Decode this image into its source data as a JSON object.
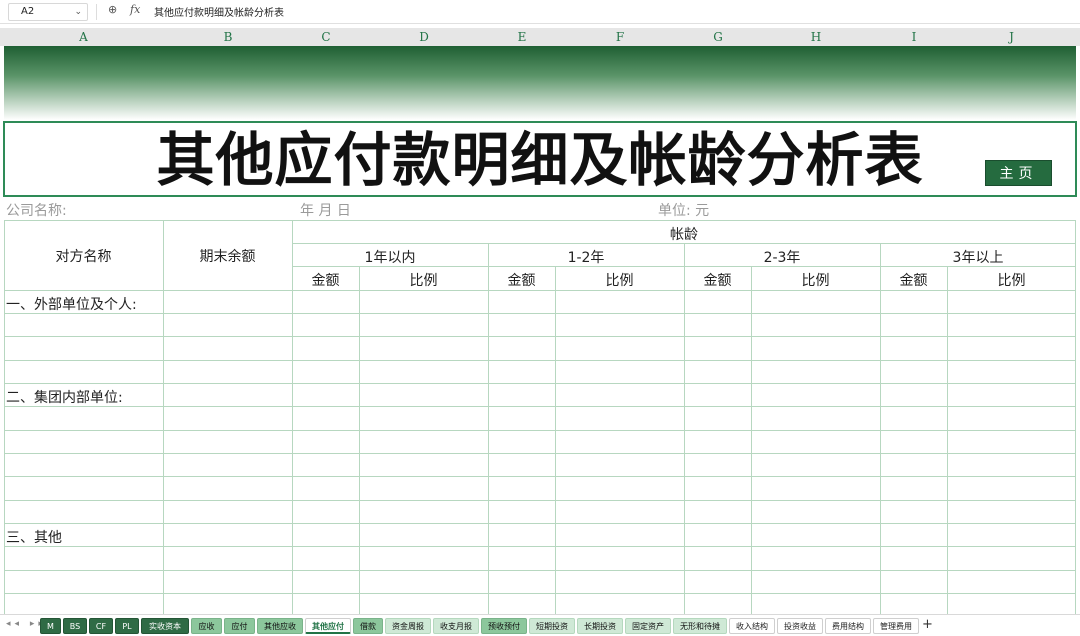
{
  "formula_bar": {
    "cell_ref": "A2",
    "dropdown_glyph": "⌄",
    "zoom_glyph": "⊕",
    "fx_label": "fx",
    "formula": "其他应付款明细及帐龄分析表"
  },
  "columns": [
    "A",
    "B",
    "C",
    "D",
    "E",
    "F",
    "G",
    "H",
    "I",
    "J"
  ],
  "sheet": {
    "title": "其他应付款明细及帐龄分析表",
    "home_button": "主页",
    "company_label": "公司名称:",
    "date_label": "年    月    日",
    "unit_label": "单位: 元",
    "headers": {
      "counterparty": "对方名称",
      "ending_balance": "期末余额",
      "aging": "帐龄",
      "buckets": [
        "1年以内",
        "1-2年",
        "2-3年",
        "3年以上"
      ],
      "amount": "金额",
      "ratio": "比例"
    },
    "sections": {
      "external": "一、外部单位及个人:",
      "internal": "二、集团内部单位:",
      "other": "三、其他"
    }
  },
  "tabs": {
    "nav": "◂◂ ▸▸",
    "items": [
      {
        "label": "M",
        "style": "dark"
      },
      {
        "label": "BS",
        "style": "dark"
      },
      {
        "label": "CF",
        "style": "dark"
      },
      {
        "label": "PL",
        "style": "dark"
      },
      {
        "label": "实收资本",
        "style": "dark"
      },
      {
        "label": "应收",
        "style": "mid"
      },
      {
        "label": "应付",
        "style": "mid"
      },
      {
        "label": "其他应收",
        "style": "mid"
      },
      {
        "label": "其他应付",
        "style": "active"
      },
      {
        "label": "借款",
        "style": "mid"
      },
      {
        "label": "资金周报",
        "style": "light"
      },
      {
        "label": "收支月报",
        "style": "light"
      },
      {
        "label": "预收预付",
        "style": "mid"
      },
      {
        "label": "短期投资",
        "style": "light"
      },
      {
        "label": "长期投资",
        "style": "light"
      },
      {
        "label": "固定资产",
        "style": "light"
      },
      {
        "label": "无形和待摊",
        "style": "light"
      },
      {
        "label": "收入结构",
        "style": "plain"
      },
      {
        "label": "投资收益",
        "style": "plain"
      },
      {
        "label": "费用结构",
        "style": "plain"
      },
      {
        "label": "管理费用",
        "style": "plain"
      }
    ],
    "add": "+"
  }
}
